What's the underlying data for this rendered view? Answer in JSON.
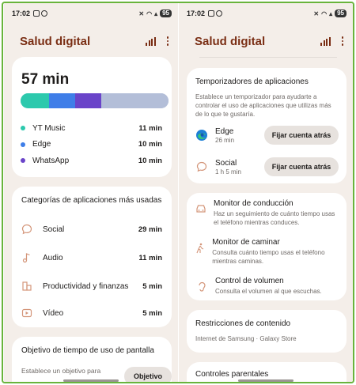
{
  "left": {
    "status": {
      "time": "17:02",
      "battery": "95"
    },
    "app_title": "Salud digital",
    "usage": {
      "total": "57 min",
      "segments": [
        {
          "app": "YT Music",
          "minutes": 11,
          "color": "#2cc9ad"
        },
        {
          "app": "Edge",
          "minutes": 10,
          "color": "#3f7ee8"
        },
        {
          "app": "WhatsApp",
          "minutes": 10,
          "color": "#6a44c9"
        },
        {
          "app": "Otros",
          "minutes": 26,
          "color": "#b3bed8"
        }
      ],
      "legend": [
        {
          "label": "YT Music",
          "value": "11 min",
          "color": "#2cc9ad"
        },
        {
          "label": "Edge",
          "value": "10 min",
          "color": "#3f7ee8"
        },
        {
          "label": "WhatsApp",
          "value": "10 min",
          "color": "#6a44c9"
        }
      ]
    },
    "categories": {
      "title": "Categorías de aplicaciones más usadas",
      "items": [
        {
          "label": "Social",
          "value": "29 min",
          "icon": "chat-bubble-icon"
        },
        {
          "label": "Audio",
          "value": "11 min",
          "icon": "music-note-icon"
        },
        {
          "label": "Productividad y finanzas",
          "value": "5 min",
          "icon": "briefcase-icon"
        },
        {
          "label": "Vídeo",
          "value": "5 min",
          "icon": "play-icon"
        }
      ]
    },
    "goal": {
      "title": "Objetivo de tiempo de uso de pantalla",
      "desc": "Establece un objetivo para",
      "button": "Objetivo"
    }
  },
  "right": {
    "status": {
      "time": "17:02",
      "battery": "95"
    },
    "app_title": "Salud digital",
    "timers": {
      "title": "Temporizadores de aplicaciones",
      "desc": "Establece un temporizador para ayudarte a controlar el uso de aplicaciones que utilizas más de lo que te gustaría.",
      "items": [
        {
          "name": "Edge",
          "sub": "26 min",
          "button": "Fijar cuenta atrás",
          "icon": "edge-icon"
        },
        {
          "name": "Social",
          "sub": "1 h 5 min",
          "button": "Fijar cuenta atrás",
          "icon": "chat-bubble-icon"
        }
      ]
    },
    "monitors": [
      {
        "title": "Monitor de conducción",
        "desc": "Haz un seguimiento de cuánto tiempo usas el teléfono mientras conduces.",
        "icon": "car-icon"
      },
      {
        "title": "Monitor de caminar",
        "desc": "Consulta cuánto tiempo usas el teléfono mientras caminas.",
        "icon": "walking-icon"
      },
      {
        "title": "Control de volumen",
        "desc": "Consulta el volumen al que escuchas.",
        "icon": "ear-icon"
      }
    ],
    "restrictions": {
      "title": "Restricciones de contenido",
      "desc": "Internet de Samsung · Galaxy Store"
    },
    "parental": {
      "title": "Controles parentales"
    }
  },
  "colors": {
    "accent": "#7a2e14",
    "icon": "#d4967a",
    "background": "#f4eee9"
  }
}
